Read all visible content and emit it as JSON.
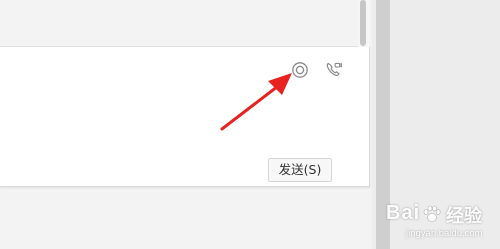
{
  "input_toolbar": {
    "screen_record_icon": "screen-record-icon",
    "voice_call_icon": "voice-call-icon"
  },
  "send_button": {
    "label": "发送(S)"
  },
  "annotation": {
    "arrow_color": "#e8231f"
  },
  "watermark": {
    "brand_left": "Bai",
    "brand_right": "经验",
    "url": "jingyan.baidu.com"
  },
  "colors": {
    "accent": "#e8231f",
    "panel": "#ffffff",
    "background": "#ededed"
  }
}
